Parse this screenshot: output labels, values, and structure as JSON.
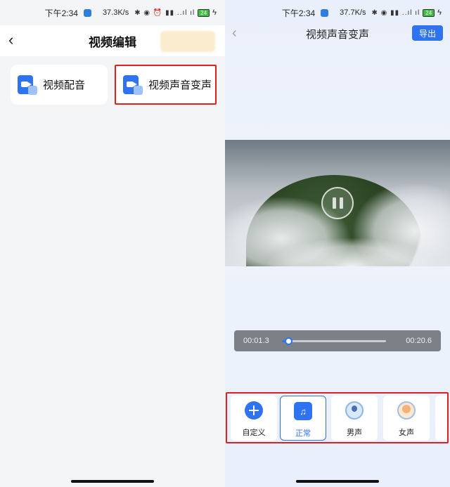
{
  "left": {
    "status": {
      "time": "下午2:34",
      "net": "37.3K/s",
      "battery": "24"
    },
    "header": {
      "title": "视频编辑"
    },
    "cards": [
      {
        "label": "视频配音"
      },
      {
        "label": "视频声音变声"
      }
    ]
  },
  "right": {
    "status": {
      "time": "下午2:34",
      "net": "37.7K/s",
      "battery": "24"
    },
    "header": {
      "title": "视频声音变声",
      "export_label": "导出"
    },
    "player": {
      "current_time": "00:01.3",
      "total_time": "00:20.6",
      "progress": 0.06
    },
    "voices": [
      {
        "label": "自定义",
        "icon": "add-icon"
      },
      {
        "label": "正常",
        "icon": "music-note-icon",
        "selected": true
      },
      {
        "label": "男声",
        "icon": "male-avatar-icon"
      },
      {
        "label": "女声",
        "icon": "female-avatar-icon"
      }
    ]
  },
  "colors": {
    "accent": "#2f73f0",
    "highlight": "#e02020"
  }
}
